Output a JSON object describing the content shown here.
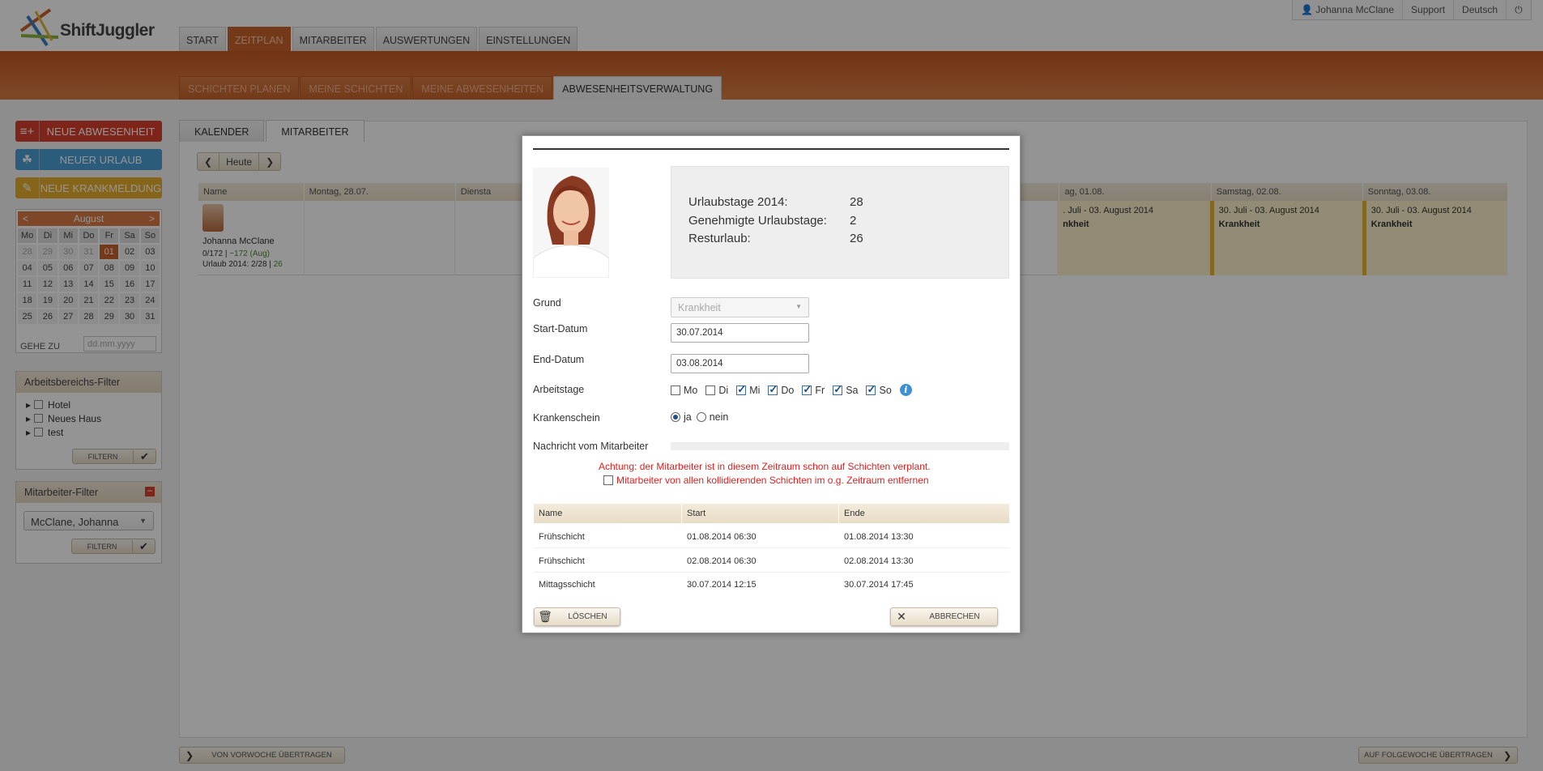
{
  "app": {
    "brand": "ShiftJuggler",
    "accent": "#c8622c"
  },
  "util_nav": {
    "user": "Johanna McClane",
    "support": "Support",
    "language": "Deutsch",
    "power_icon": "power-icon"
  },
  "main_nav": [
    "START",
    "ZEITPLAN",
    "MITARBEITER",
    "AUSWERTUNGEN",
    "EINSTELLUNGEN"
  ],
  "sub_nav": [
    "SCHICHTEN PLANEN",
    "MEINE SCHICHTEN",
    "MEINE ABWESENHEITEN",
    "ABWESENHEITSVERWALTUNG"
  ],
  "sidebar": {
    "new_absence": "NEUE ABWESENHEIT",
    "new_vacation": "NEUER URLAUB",
    "new_sick": "NEUE KRANKMELDUNG",
    "calendar": {
      "prev": "<",
      "next": ">",
      "month": "August",
      "weekdays": [
        "Mo",
        "Di",
        "Mi",
        "Do",
        "Fr",
        "Sa",
        "So"
      ],
      "days": [
        "28",
        "29",
        "30",
        "31",
        "01",
        "02",
        "03",
        "04",
        "05",
        "06",
        "07",
        "08",
        "09",
        "10",
        "11",
        "12",
        "13",
        "14",
        "15",
        "16",
        "17",
        "18",
        "19",
        "20",
        "21",
        "22",
        "23",
        "24",
        "25",
        "26",
        "27",
        "28",
        "29",
        "30",
        "31"
      ],
      "goto_label": "GEHE ZU",
      "goto_placeholder": "dd.mm.yyyy"
    },
    "area_filter": {
      "title": "Arbeitsbereichs-Filter",
      "items": [
        "Hotel",
        "Neues Haus",
        "test"
      ],
      "button": "FILTERN"
    },
    "employee_filter": {
      "title": "Mitarbeiter-Filter",
      "selected": "McClane, Johanna",
      "button": "FILTERN"
    }
  },
  "panel": {
    "tabs": [
      "KALENDER",
      "MITARBEITER"
    ],
    "today": "Heute",
    "columns": [
      "Name",
      "Montag, 28.07.",
      "Diensta",
      "ag, 01.08.",
      "Samstag, 02.08.",
      "Sonntag, 03.08."
    ],
    "row": {
      "name": "Johanna McClane",
      "hours": "0/172",
      "sep": "|",
      "delta": "−172 (Aug)",
      "vacation": "Urlaub 2014: 2/28 |",
      "vacation_rest": "26",
      "absence_range": "30. Juli - 03. August 2014",
      "absence_range_cut": ". Juli - 03. August 2014",
      "absence_type": "Krankheit",
      "absence_type_cut": "nkheit"
    },
    "copy_prev": "VON VORWOCHE ÜBERTRAGEN",
    "copy_next": "AUF FOLGEWOCHE ÜBERTRAGEN"
  },
  "modal": {
    "stats": [
      {
        "label": "Urlaubstage 2014:",
        "value": "28"
      },
      {
        "label": "Genehmigte Urlaubstage:",
        "value": "2"
      },
      {
        "label": "Resturlaub:",
        "value": "26"
      }
    ],
    "reason_label": "Grund",
    "reason_value": "Krankheit",
    "start_label": "Start-Datum",
    "start_value": "30.07.2014",
    "end_label": "End-Datum",
    "end_value": "03.08.2014",
    "workdays_label": "Arbeitstage",
    "workdays": [
      {
        "day": "Mo",
        "checked": false
      },
      {
        "day": "Di",
        "checked": false
      },
      {
        "day": "Mi",
        "checked": true
      },
      {
        "day": "Do",
        "checked": true
      },
      {
        "day": "Fr",
        "checked": true
      },
      {
        "day": "Sa",
        "checked": true
      },
      {
        "day": "So",
        "checked": true
      }
    ],
    "info_icon": "i",
    "sick_note_label": "Krankenschein",
    "sick_yes": "ja",
    "sick_no": "nein",
    "message_label": "Nachricht vom Mitarbeiter",
    "warning": "Achtung: der Mitarbeiter ist in diesem Zeitraum schon auf Schichten verplant.",
    "remove_label": "Mitarbeiter von allen kollidierenden Schichten im o.g. Zeitraum entfernen",
    "table_headers": [
      "Name",
      "Start",
      "Ende"
    ],
    "shifts": [
      {
        "name": "Frühschicht",
        "start": "01.08.2014 06:30",
        "end": "01.08.2014 13:30"
      },
      {
        "name": "Frühschicht",
        "start": "02.08.2014 06:30",
        "end": "02.08.2014 13:30"
      },
      {
        "name": "Mittagsschicht",
        "start": "30.07.2014 12:15",
        "end": "30.07.2014 17:45"
      }
    ],
    "delete_button": "LÖSCHEN",
    "cancel_button": "ABBRECHEN"
  }
}
